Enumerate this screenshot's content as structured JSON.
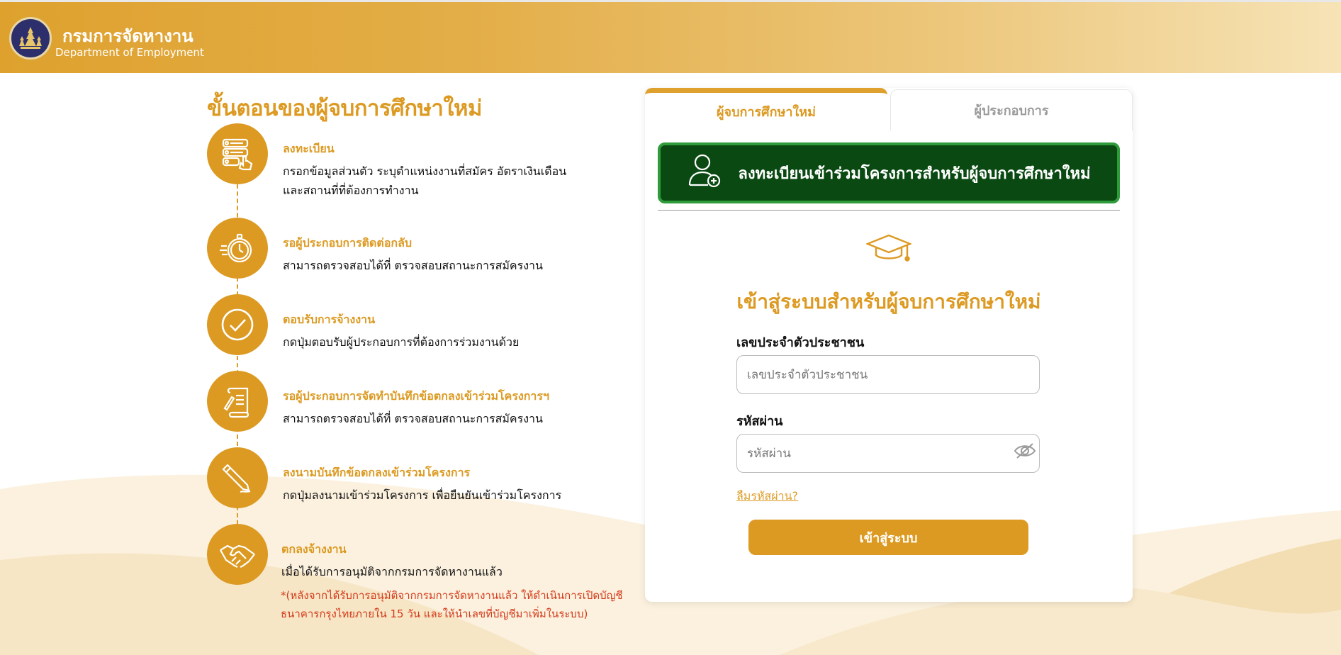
{
  "header": {
    "org_name_th": "กรมการจัดหางาน",
    "org_name_en": "Department of Employment"
  },
  "steps": {
    "title": "ขั้นตอนของผู้จบการศึกษาใหม่",
    "items": [
      {
        "icon": "form-touch-icon",
        "title": "ลงทะเบียน",
        "desc": [
          "กรอกข้อมูลส่วนตัว ระบุตำแหน่งงานที่สมัคร อัตราเงินเดือน",
          " และสถานที่ที่ต้องการทำงาน"
        ]
      },
      {
        "icon": "stopwatch-icon",
        "title": "รอผู้ประกอบการติดต่อกลับ",
        "desc": [
          "สามารถตรวจสอบได้ที่  ตรวจสอบสถานะการสมัครงาน"
        ]
      },
      {
        "icon": "check-circle-icon",
        "title": "ตอบรับการจ้างงาน",
        "desc": [
          "กดปุ่มตอบรับผู้ประกอบการที่ต้องการร่วมงานด้วย"
        ]
      },
      {
        "icon": "scroll-contract-icon",
        "title": "รอผู้ประกอบการจัดทำบันทึกข้อตกลงเข้าร่วมโครงการฯ",
        "desc": [
          "สามารถตรวจสอบได้ที่  ตรวจสอบสถานะการสมัครงาน"
        ]
      },
      {
        "icon": "pen-sign-icon",
        "title": "ลงนามบันทึกข้อตกลงเข้าร่วมโครงการ",
        "desc": [
          "กดปุ่มลงนามเข้าร่วมโครงการ เพื่อยืนยันเข้าร่วมโครงการ"
        ]
      },
      {
        "icon": "handshake-icon",
        "title": "ตกลงจ้างงาน",
        "desc": [
          "เมื่อได้รับการอนุมัติจากกรมการจัดหางานแล้ว"
        ],
        "note": [
          "*(หลังจากได้รับการอนุมัติจากกรมการจัดหางานแล้ว ให้ดำเนินการเปิดบัญชี",
          "ธนาคารกรุงไทยภายใน 15 วัน และให้นำเลขที่บัญชีมาเพิ่มในระบบ)"
        ]
      }
    ]
  },
  "tabs": {
    "graduate": "ผู้จบการศึกษาใหม่",
    "employer": "ผู้ประกอบการ"
  },
  "register": {
    "label": "ลงทะเบียนเข้าร่วมโครงการสำหรับผู้จบการศึกษาใหม่",
    "icon": "user-plus-icon"
  },
  "login": {
    "icon": "graduation-cap-icon",
    "title": "เข้าสู่ระบบสำหรับผู้จบการศึกษาใหม่",
    "id_label": "เลขประจำตัวประชาชน",
    "id_placeholder": "เลขประจำตัวประชาชน",
    "password_label": "รหัสผ่าน",
    "password_placeholder": "รหัสผ่าน",
    "forgot": "ลืมรหัสผ่าน?",
    "submit": "เข้าสู่ระบบ"
  },
  "colors": {
    "brand": "#dc9a22",
    "register_bg": "#0a4a12",
    "register_border": "#2f9c3b",
    "note": "#d43a1a"
  }
}
